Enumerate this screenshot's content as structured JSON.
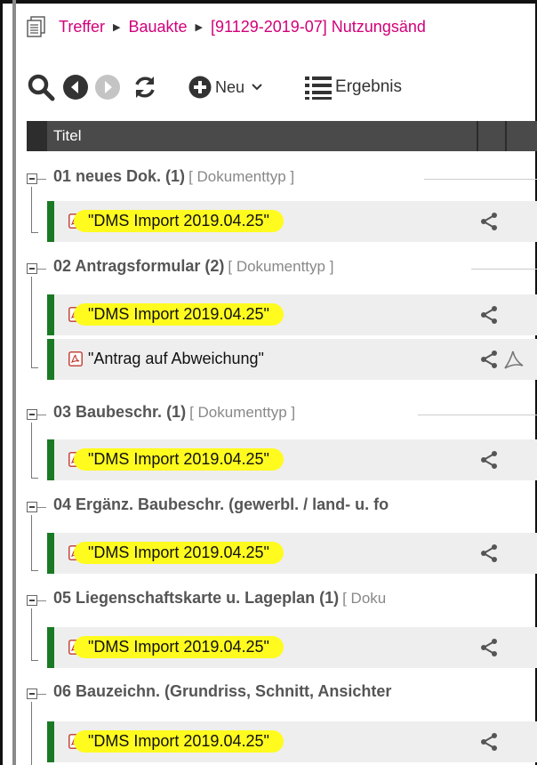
{
  "breadcrumb": {
    "items": [
      "Treffer",
      "Bauakte",
      "[91129-2019-07] Nutzungsänd"
    ]
  },
  "toolbar": {
    "new_label": "Neu",
    "results_label": "Ergebnis"
  },
  "table": {
    "column_title": "Titel"
  },
  "groups": [
    {
      "title": "01 neues Dok. (1)",
      "type": "[ Dokumenttyp ]",
      "docs": [
        {
          "title": "\"DMS Import 2019.04.25\""
        }
      ]
    },
    {
      "title": "02 Antragsformular (2)",
      "type": "[ Dokumenttyp ]",
      "docs": [
        {
          "title": "\"DMS Import 2019.04.25\""
        },
        {
          "title": "\"Antrag auf Abweichung\""
        }
      ]
    },
    {
      "title": "03 Baubeschr. (1)",
      "type": "[ Dokumenttyp ]",
      "docs": [
        {
          "title": "\"DMS Import 2019.04.25\""
        }
      ]
    },
    {
      "title": "04 Ergänz. Baubeschr. (gewerbl. / land- u. fo",
      "type": "",
      "docs": [
        {
          "title": "\"DMS Import 2019.04.25\""
        }
      ]
    },
    {
      "title": "05 Liegenschaftskarte u. Lageplan (1)",
      "type": "[ Doku",
      "docs": [
        {
          "title": "\"DMS Import 2019.04.25\""
        }
      ]
    },
    {
      "title": "06 Bauzeichn. (Grundriss, Schnitt, Ansichter",
      "type": "",
      "docs": [
        {
          "title": "\"DMS Import 2019.04.25\""
        }
      ]
    }
  ],
  "colors": {
    "breadcrumb_link": "#d1007a",
    "header_bg": "#4a4a4a",
    "doc_bar": "#1a7a24",
    "highlight": "#fffb1e"
  }
}
